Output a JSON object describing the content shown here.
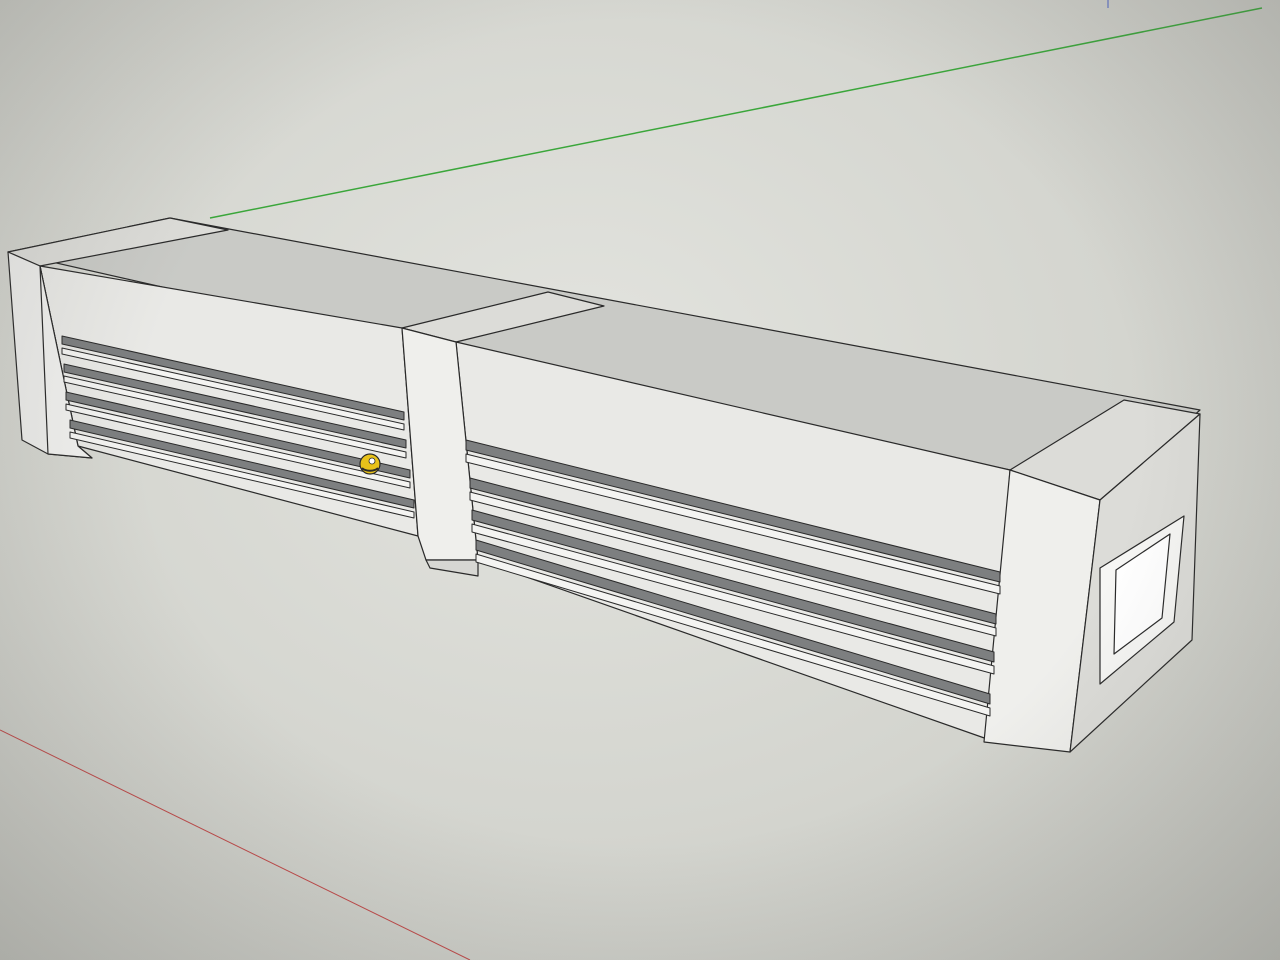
{
  "app": {
    "name": ""
  },
  "scene": {
    "background_color": "#d6d7d2",
    "axis_colors": {
      "green_axis": "#3aa63a",
      "red_axis": "#c04848"
    },
    "model": {
      "face_top_color": "#c9cac6",
      "face_front_color": "#e9e9e6",
      "face_side_color": "#dcdcd8",
      "edge_color": "#2a2a2a",
      "slat_shadow_color": "#7d7f80"
    },
    "cursor": {
      "icon": "orbit-cursor-icon",
      "colors": [
        "#e8c21a",
        "#2a2a2a"
      ]
    }
  }
}
